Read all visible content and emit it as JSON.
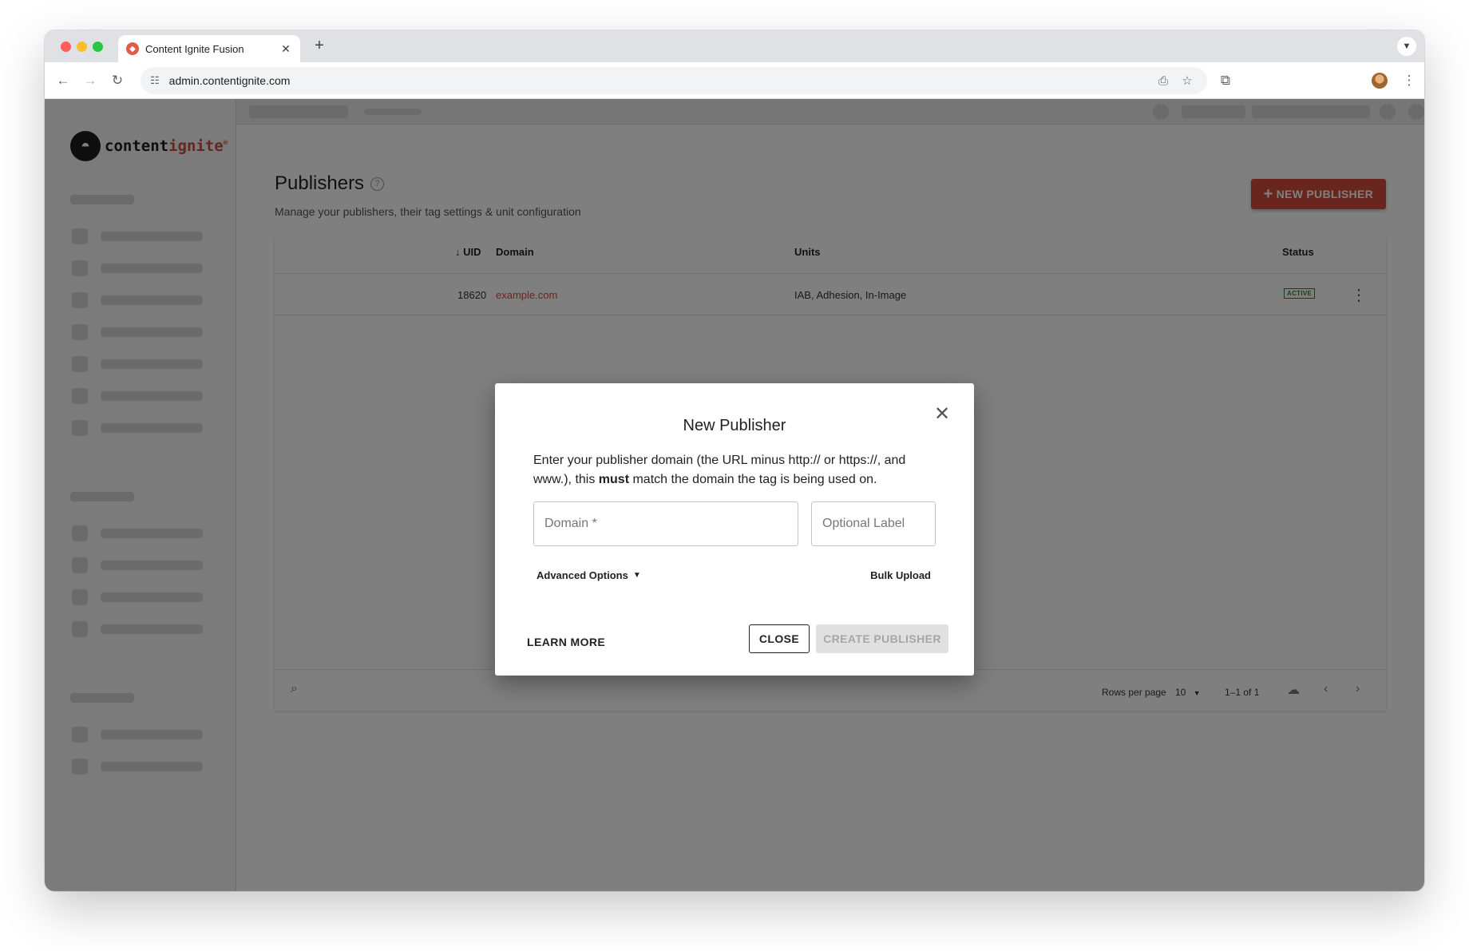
{
  "browser": {
    "tab_title": "Content Ignite Fusion",
    "tab_close": "✕",
    "new_tab": "+",
    "url": "admin.contentignite.com"
  },
  "logo": {
    "text_main": "content",
    "text_accent": "ignite",
    "registered": "®"
  },
  "page": {
    "title": "Publishers",
    "subtitle": "Manage your publishers, their tag settings & unit configuration",
    "new_button": "NEW PUBLISHER"
  },
  "table": {
    "columns": {
      "uid": "UID",
      "domain": "Domain",
      "units": "Units",
      "status": "Status"
    },
    "rows": [
      {
        "uid": "18620",
        "domain": "example.com",
        "units": "IAB, Adhesion, In-Image",
        "status": "ACTIVE"
      }
    ],
    "footer": {
      "rows_per_page_label": "Rows per page",
      "rows_per_page": "10",
      "range": "1–1 of 1"
    }
  },
  "dialog": {
    "title": "New Publisher",
    "text_before": "Enter your publisher domain (the URL minus http:// or https://, and www.), this ",
    "text_bold": "must",
    "text_after": " match the domain the tag is being used on.",
    "domain_placeholder": "Domain *",
    "label_placeholder": "Optional Label",
    "advanced_options": "Advanced Options",
    "bulk_upload": "Bulk Upload",
    "learn_more": "LEARN MORE",
    "close_button": "CLOSE",
    "create_button": "CREATE PUBLISHER"
  },
  "colors": {
    "brand": "#d24d3d",
    "active_status": "#2e7d32",
    "domain_link": "#d24d3d"
  }
}
